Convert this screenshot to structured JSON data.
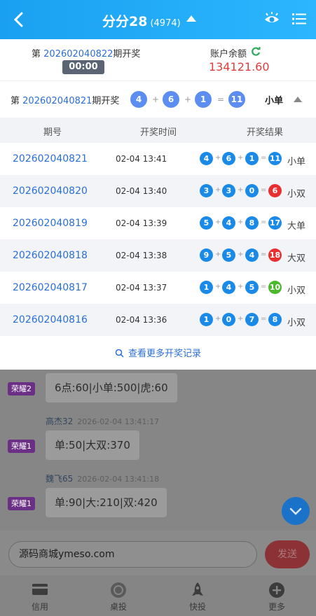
{
  "header": {
    "title": "分分28",
    "count": "(4974)"
  },
  "current": {
    "prefix": "第",
    "issue": "202602040822",
    "suffix": "期开奖",
    "countdown": "00:00"
  },
  "balance": {
    "label": "账户余额",
    "value": "134121.60"
  },
  "last_draw": {
    "prefix": "第",
    "issue": "202602040821",
    "suffix": "期开奖",
    "balls": [
      "4",
      "6",
      "1"
    ],
    "sum": "11",
    "result": "小单",
    "plus": "+",
    "equals": "="
  },
  "table": {
    "headers": [
      "期号",
      "开奖时间",
      "开奖结果"
    ],
    "rows": [
      {
        "issue": "202602040821",
        "time": "02-04 13:41",
        "b1": "4",
        "b2": "6",
        "b3": "1",
        "sum": "11",
        "sum_color": "#1a8ae8",
        "tag": "小单"
      },
      {
        "issue": "202602040820",
        "time": "02-04 13:40",
        "b1": "3",
        "b2": "3",
        "b3": "0",
        "sum": "6",
        "sum_color": "#e83030",
        "tag": "小双"
      },
      {
        "issue": "202602040819",
        "time": "02-04 13:39",
        "b1": "5",
        "b2": "4",
        "b3": "8",
        "sum": "17",
        "sum_color": "#1a8ae8",
        "tag": "大单"
      },
      {
        "issue": "202602040818",
        "time": "02-04 13:38",
        "b1": "9",
        "b2": "5",
        "b3": "4",
        "sum": "18",
        "sum_color": "#e83030",
        "tag": "大双"
      },
      {
        "issue": "202602040817",
        "time": "02-04 13:37",
        "b1": "1",
        "b2": "4",
        "b3": "5",
        "sum": "10",
        "sum_color": "#4cb82c",
        "tag": "小双"
      },
      {
        "issue": "202602040816",
        "time": "02-04 13:36",
        "b1": "1",
        "b2": "0",
        "b3": "7",
        "sum": "8",
        "sum_color": "#1a8ae8",
        "tag": "小双"
      }
    ],
    "more_label": "查看更多开奖记录"
  },
  "chat": {
    "messages": [
      {
        "badge": "荣耀2",
        "text": "6点:60|小单:500|虎:60"
      },
      {
        "sender": "高杰32",
        "time": "2026-02-04 13:41:17",
        "badge": "荣耀1",
        "text": "单:50|大双:370"
      },
      {
        "sender": "魏飞65",
        "time": "2026-02-04 13:41:18",
        "badge": "荣耀1",
        "text": "单:90|大:210|双:420"
      }
    ],
    "input_value": "源码商城ymeso.com",
    "send_label": "发送"
  },
  "tabs": [
    {
      "label": "信用",
      "icon": "credit-card-icon"
    },
    {
      "label": "桌投",
      "icon": "chip-icon"
    },
    {
      "label": "快投",
      "icon": "rocket-icon"
    },
    {
      "label": "更多",
      "icon": "plus-circle-icon"
    }
  ],
  "colors": {
    "header": "#1aa0f0",
    "ball_blue": "#1a8ae8",
    "ball_red": "#e83030",
    "ball_green": "#4cb82c",
    "balance": "#e23b3b",
    "badge": "#6b2f86"
  }
}
